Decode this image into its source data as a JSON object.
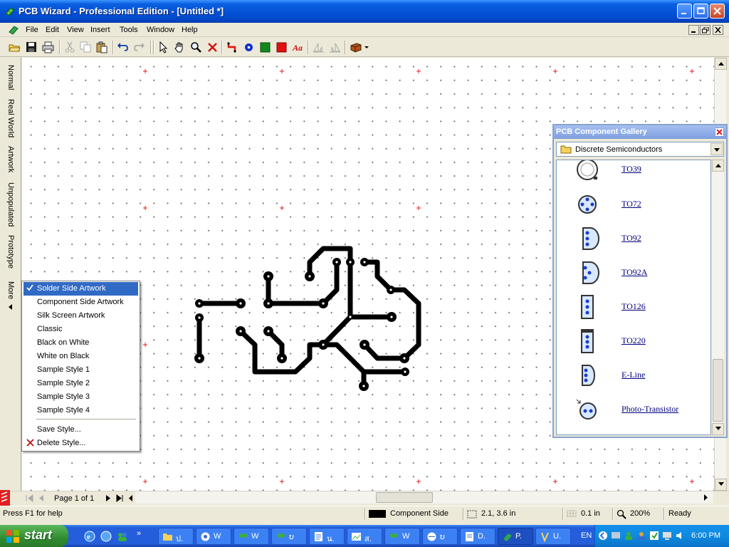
{
  "window": {
    "title": "PCB Wizard - Professional Edition - [Untitled *]"
  },
  "menubar": {
    "items": [
      "File",
      "Edit",
      "View",
      "Insert",
      "Tools",
      "Window",
      "Help"
    ]
  },
  "toolbar": {
    "icons": [
      "open-icon",
      "save-icon",
      "print-icon",
      "cut-icon",
      "copy-icon",
      "paste-icon",
      "undo-icon",
      "redo-icon",
      "select-pointer-icon",
      "pan-hand-icon",
      "zoom-icon",
      "delete-x-icon",
      "track-icon",
      "pad-icon",
      "smd-green-icon",
      "smd-red-icon",
      "text-aa-icon",
      "align-left-icon",
      "align-right-icon",
      "component-box-icon"
    ]
  },
  "side_tabs": {
    "items": [
      "Normal",
      "Real World",
      "Artwork",
      "Unpopulated",
      "Prototype",
      "More"
    ]
  },
  "style_menu": {
    "items": [
      {
        "label": "Solder Side Artwork",
        "checked": true,
        "selected": true
      },
      {
        "label": "Component Side Artwork"
      },
      {
        "label": "Silk Screen Artwork"
      },
      {
        "label": "Classic"
      },
      {
        "label": "Black on White"
      },
      {
        "label": "White on Black"
      },
      {
        "label": "Sample Style 1"
      },
      {
        "label": "Sample Style 2"
      },
      {
        "label": "Sample Style 3"
      },
      {
        "label": "Sample Style 4"
      }
    ],
    "actions": [
      {
        "label": "Save Style..."
      },
      {
        "label": "Delete Style..."
      }
    ]
  },
  "gallery": {
    "title": "PCB Component Gallery",
    "category": "Discrete Semiconductors",
    "items": [
      "TO39",
      "TO72",
      "TO92",
      "TO92A",
      "TO126",
      "TO220",
      "E-Line",
      "Photo-Transistor"
    ]
  },
  "page_nav": {
    "label": "Page 1 of 1"
  },
  "status": {
    "help": "Press F1 for help",
    "layer": "Component Side",
    "coords": "2.1, 3.6 in",
    "grid": "0.1 in",
    "zoom": "200%",
    "state": "Ready",
    "layer_swatch_color": "#000000"
  },
  "taskbar": {
    "start": "start",
    "tasks": [
      "ป.",
      "W",
      "W",
      "ບ",
      "น.",
      "ส.",
      "W",
      "ບ",
      "D.",
      "P.",
      "U."
    ],
    "language": "EN",
    "clock": "6:00 PM"
  },
  "colors": {
    "track": "#000000",
    "grid_cross": "#e02020",
    "title_blue": "#0453d8",
    "menu_highlight": "#316ac5"
  }
}
